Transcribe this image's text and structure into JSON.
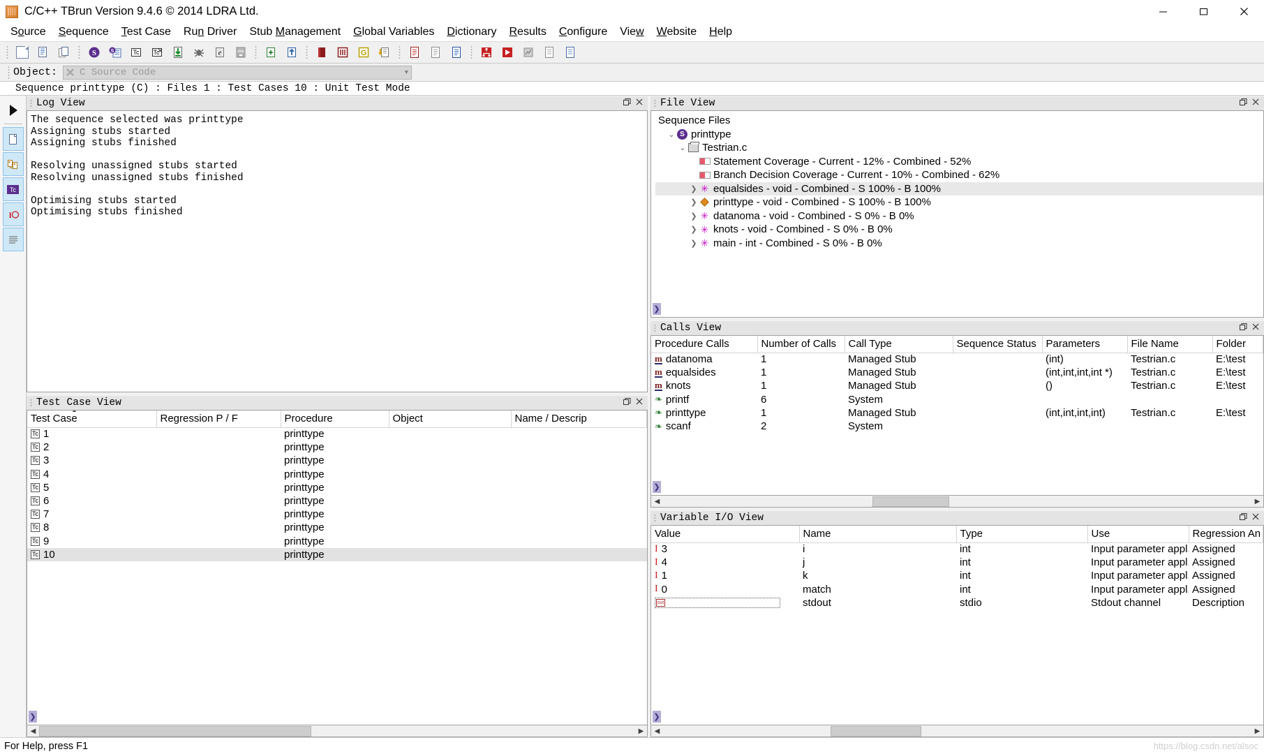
{
  "window": {
    "title": "C/C++ TBrun Version 9.4.6 © 2014 LDRA Ltd.",
    "app_icon": "tbrun-app-icon",
    "minimize": "—",
    "maximize": "▭",
    "close": "✕"
  },
  "menubar": {
    "items": [
      {
        "label": "Source",
        "accel": "o"
      },
      {
        "label": "Sequence",
        "accel": "S"
      },
      {
        "label": "Test Case",
        "accel": "T"
      },
      {
        "label": "Run Driver",
        "accel": "n"
      },
      {
        "label": "Stub Management",
        "accel": "M"
      },
      {
        "label": "Global Variables",
        "accel": "G"
      },
      {
        "label": "Dictionary",
        "accel": "D"
      },
      {
        "label": "Results",
        "accel": "R"
      },
      {
        "label": "Configure",
        "accel": "C"
      },
      {
        "label": "View",
        "accel": "w"
      },
      {
        "label": "Website",
        "accel": "W"
      },
      {
        "label": "Help",
        "accel": "H"
      }
    ]
  },
  "toolbar": {
    "groups": [
      [
        "new-file-icon",
        "copy-file-icon",
        "duplicate-file-icon"
      ],
      [
        "sequence-icon",
        "sequence-list-icon",
        "test-case-icon",
        "test-case-delete-icon",
        "import-test-case-icon",
        "debug-bug-icon",
        "execute-icon",
        "stop-icon"
      ],
      [
        "generate-driver-icon",
        "run-driver-icon"
      ],
      [
        "book-red-icon",
        "book-maroon-icon",
        "global-variables-icon",
        "dictionary-import-icon"
      ],
      [
        "report-red-icon",
        "report-grey-icon",
        "report-blue-icon"
      ],
      [
        "analysis-red-icon",
        "play-report-icon",
        "graph-grey-icon",
        "document-grey-icon",
        "document-blue-icon"
      ]
    ]
  },
  "object_bar": {
    "label": "Object:",
    "icon": "tools-icon",
    "value": "C Source Code",
    "dropdown_icon": "chevron-down-icon"
  },
  "sequence_bar": {
    "text": "Sequence printtype (C) : Files 1 : Test Cases 10 : Unit Test Mode"
  },
  "left_rail": {
    "play_icon": "play-arrow-icon",
    "buttons": [
      {
        "name": "source-file-icon",
        "glyph": "page"
      },
      {
        "name": "stub-management-icon",
        "glyph": "stub"
      },
      {
        "name": "test-case-icon",
        "glyph": "Tc"
      },
      {
        "name": "variable-io-icon",
        "glyph": "IO"
      },
      {
        "name": "log-list-icon",
        "glyph": "lines"
      }
    ]
  },
  "log_view": {
    "title": "Log View",
    "restore_icon": "restore-icon",
    "close_icon": "close-icon",
    "lines": [
      "The sequence selected was printtype",
      "Assigning stubs started",
      "Assigning stubs finished",
      "",
      "Resolving unassigned stubs started",
      "Resolving unassigned stubs finished",
      "",
      "Optimising stubs started",
      "Optimising stubs finished"
    ]
  },
  "test_case_view": {
    "title": "Test Case View",
    "restore_icon": "restore-icon",
    "close_icon": "close-icon",
    "columns": [
      "Test Case",
      "Regression P / F",
      "Procedure",
      "Object",
      "Name / Descrip"
    ],
    "sort_indicator": "▲",
    "rows": [
      {
        "test_case": "1",
        "regression": "",
        "procedure": "printtype",
        "object": "",
        "name": "",
        "selected": false
      },
      {
        "test_case": "2",
        "regression": "",
        "procedure": "printtype",
        "object": "",
        "name": "",
        "selected": false
      },
      {
        "test_case": "3",
        "regression": "",
        "procedure": "printtype",
        "object": "",
        "name": "",
        "selected": false
      },
      {
        "test_case": "4",
        "regression": "",
        "procedure": "printtype",
        "object": "",
        "name": "",
        "selected": false
      },
      {
        "test_case": "5",
        "regression": "",
        "procedure": "printtype",
        "object": "",
        "name": "",
        "selected": false
      },
      {
        "test_case": "6",
        "regression": "",
        "procedure": "printtype",
        "object": "",
        "name": "",
        "selected": false
      },
      {
        "test_case": "7",
        "regression": "",
        "procedure": "printtype",
        "object": "",
        "name": "",
        "selected": false
      },
      {
        "test_case": "8",
        "regression": "",
        "procedure": "printtype",
        "object": "",
        "name": "",
        "selected": false
      },
      {
        "test_case": "9",
        "regression": "",
        "procedure": "printtype",
        "object": "",
        "name": "",
        "selected": false
      },
      {
        "test_case": "10",
        "regression": "",
        "procedure": "printtype",
        "object": "",
        "name": "",
        "selected": true
      }
    ]
  },
  "file_view": {
    "title": "File View",
    "restore_icon": "restore-icon",
    "close_icon": "close-icon",
    "root_label": "Sequence Files",
    "nodes": [
      {
        "label": "printtype",
        "icon": "sequence-badge-icon",
        "indent": 1,
        "chevron": "expanded",
        "selected": false
      },
      {
        "label": "Testrian.c",
        "icon": "source-file-icon",
        "indent": 2,
        "chevron": "expanded",
        "selected": false
      },
      {
        "label": "Statement Coverage - Current - 12% - Combined - 52%",
        "icon": "coverage-bar-icon",
        "indent": 3,
        "chevron": "none",
        "selected": false
      },
      {
        "label": "Branch Decision Coverage - Current - 10% - Combined - 62%",
        "icon": "coverage-bar-icon",
        "indent": 3,
        "chevron": "none",
        "selected": false
      },
      {
        "label": "equalsides - void - Combined - S 100% - B 100%",
        "icon": "procedure-star-icon",
        "indent": 3,
        "chevron": "collapsed",
        "selected": true
      },
      {
        "label": "printtype - void - Combined - S 100% - B 100%",
        "icon": "procedure-diamond-icon",
        "indent": 3,
        "chevron": "collapsed",
        "selected": false
      },
      {
        "label": "datanoma - void - Combined - S 0% - B 0%",
        "icon": "procedure-star-icon",
        "indent": 3,
        "chevron": "collapsed",
        "selected": false
      },
      {
        "label": "knots - void - Combined - S 0% - B 0%",
        "icon": "procedure-star-icon",
        "indent": 3,
        "chevron": "collapsed",
        "selected": false
      },
      {
        "label": "main - int - Combined - S 0% - B 0%",
        "icon": "procedure-star-icon",
        "indent": 3,
        "chevron": "collapsed",
        "selected": false
      }
    ],
    "expander_glyph": "❯"
  },
  "calls_view": {
    "title": "Calls View",
    "restore_icon": "restore-icon",
    "close_icon": "close-icon",
    "columns": [
      "Procedure Calls",
      "Number of Calls",
      "Call Type",
      "Sequence Status",
      "Parameters",
      "File Name",
      "Folder"
    ],
    "rows": [
      {
        "icon": "managed-stub-icon",
        "procedure": "datanoma",
        "calls": "1",
        "call_type": "Managed Stub",
        "status": "",
        "parameters": "(int)",
        "file": "Testrian.c",
        "folder": "E:\\test"
      },
      {
        "icon": "managed-stub-icon",
        "procedure": "equalsides",
        "calls": "1",
        "call_type": "Managed Stub",
        "status": "",
        "parameters": "(int,int,int,int *)",
        "file": "Testrian.c",
        "folder": "E:\\test"
      },
      {
        "icon": "managed-stub-icon",
        "procedure": "knots",
        "calls": "1",
        "call_type": "Managed Stub",
        "status": "",
        "parameters": "()",
        "file": "Testrian.c",
        "folder": "E:\\test"
      },
      {
        "icon": "system-call-icon",
        "procedure": "printf",
        "calls": "6",
        "call_type": "System",
        "status": "",
        "parameters": "",
        "file": "",
        "folder": ""
      },
      {
        "icon": "system-call-icon",
        "procedure": "printtype",
        "calls": "1",
        "call_type": "Managed Stub",
        "status": "",
        "parameters": "(int,int,int,int)",
        "file": "Testrian.c",
        "folder": "E:\\test"
      },
      {
        "icon": "system-call-icon",
        "procedure": "scanf",
        "calls": "2",
        "call_type": "System",
        "status": "",
        "parameters": "",
        "file": "",
        "folder": ""
      }
    ],
    "expander_glyph": "❯"
  },
  "variable_io_view": {
    "title": "Variable I/O View",
    "restore_icon": "restore-icon",
    "close_icon": "close-icon",
    "columns": [
      "Value",
      "Name",
      "Type",
      "Use",
      "Regression An"
    ],
    "rows": [
      {
        "marker": "I",
        "value": "3",
        "name": "i",
        "type": "int",
        "use": "Input parameter appl...",
        "regression": "Assigned",
        "editing": false
      },
      {
        "marker": "I",
        "value": "4",
        "name": "j",
        "type": "int",
        "use": "Input parameter appl...",
        "regression": "Assigned",
        "editing": false
      },
      {
        "marker": "I",
        "value": "1",
        "name": "k",
        "type": "int",
        "use": "Input parameter appl...",
        "regression": "Assigned",
        "editing": false
      },
      {
        "marker": "I",
        "value": "0",
        "name": "match",
        "type": "int",
        "use": "Input parameter appl...",
        "regression": "Assigned",
        "editing": false
      },
      {
        "marker": "out",
        "value": "",
        "name": "stdout",
        "type": "stdio",
        "use": "Stdout channel",
        "regression": "Description",
        "editing": true
      }
    ],
    "expander_glyph": "❯"
  },
  "status_bar": {
    "text": "For Help, press F1",
    "watermark": "https://blog.csdn.net/alsoc"
  },
  "scrollbars": {
    "left_arrow": "◀",
    "right_arrow": "▶"
  },
  "colors": {
    "accent_purple": "#5b2d8e",
    "selection_grey": "#e2e2e2",
    "pane_header": "#e4e4e4",
    "coverage_red": "#e8596b",
    "marker_red": "#d01b1b"
  }
}
